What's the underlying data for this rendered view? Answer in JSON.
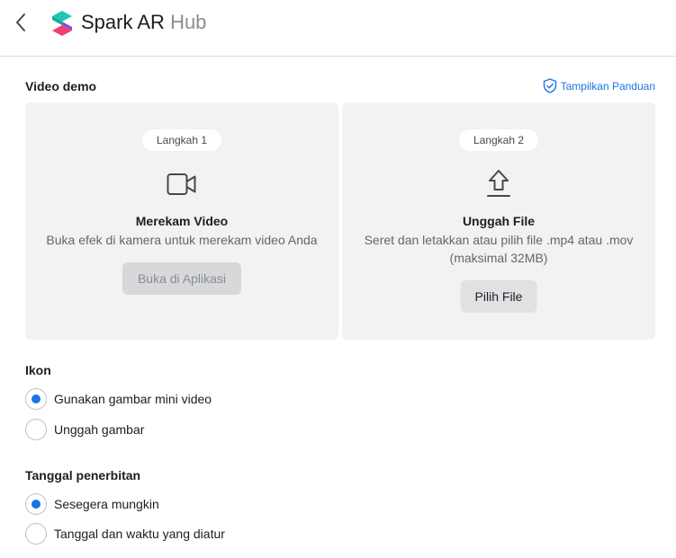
{
  "header": {
    "brand_main": "Spark AR",
    "brand_sub": "Hub"
  },
  "video_demo": {
    "title": "Video demo",
    "guide_link": "Tampilkan Panduan",
    "step1": {
      "pill": "Langkah 1",
      "heading": "Merekam Video",
      "description": "Buka efek di kamera untuk merekam video Anda",
      "button": "Buka di Aplikasi"
    },
    "step2": {
      "pill": "Langkah 2",
      "heading": "Unggah File",
      "description": "Seret dan letakkan atau pilih file .mp4 atau .mov (maksimal 32MB)",
      "button": "Pilih File"
    }
  },
  "icon_section": {
    "title": "Ikon",
    "options": [
      {
        "label": "Gunakan gambar mini video",
        "checked": true
      },
      {
        "label": "Unggah gambar",
        "checked": false
      }
    ]
  },
  "publish_section": {
    "title": "Tanggal penerbitan",
    "options": [
      {
        "label": "Sesegera mungkin",
        "checked": true
      },
      {
        "label": "Tanggal dan waktu yang diatur",
        "checked": false
      }
    ]
  },
  "colors": {
    "accent": "#1b74e4",
    "panel_bg": "#f2f2f2",
    "logo_teal": "#1ec8b4",
    "logo_pink": "#f0406e"
  }
}
